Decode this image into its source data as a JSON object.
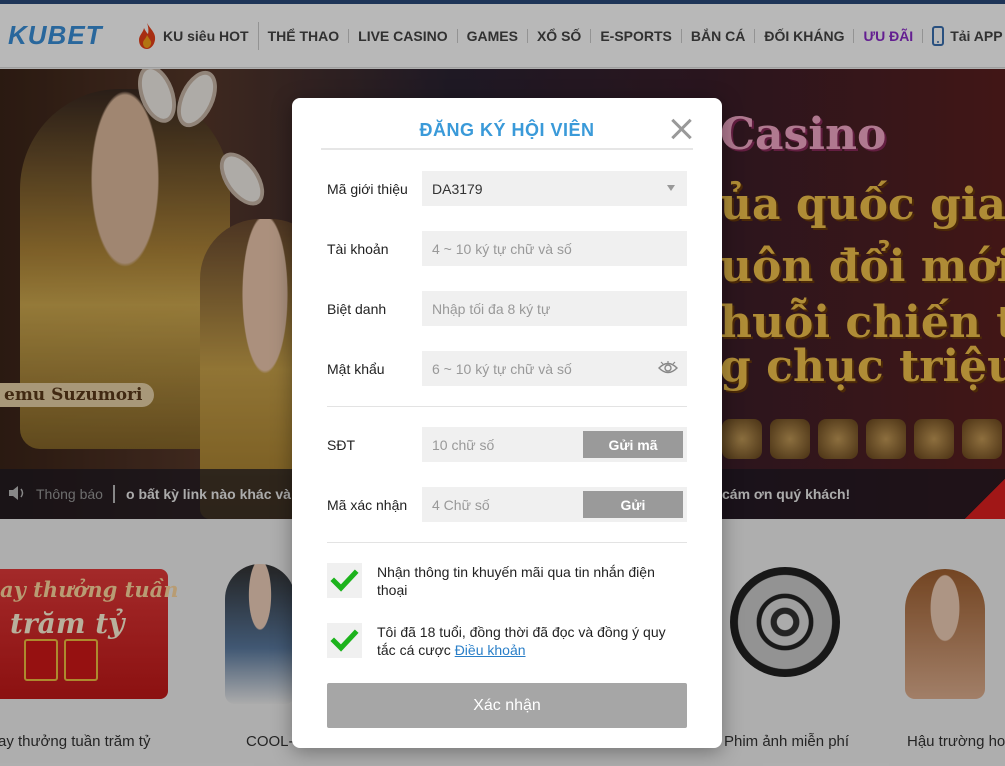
{
  "brand": {
    "logo_text": "KUBET"
  },
  "nav": {
    "items": [
      {
        "label": "KU siêu HOT",
        "icon": "fire-icon"
      },
      {
        "label": "THỂ THAO"
      },
      {
        "label": "LIVE CASINO"
      },
      {
        "label": "GAMES"
      },
      {
        "label": "XỔ SỐ"
      },
      {
        "label": "E-SPORTS"
      },
      {
        "label": "BẮN CÁ"
      },
      {
        "label": "ĐỐI KHÁNG"
      },
      {
        "label": "ƯU ĐÃI",
        "color": "#8b2cc9"
      },
      {
        "label": "Tải APP",
        "icon": "phone-icon"
      }
    ]
  },
  "banner": {
    "name_tag": "emu Suzumori",
    "headline_lines": [
      "Casino",
      "ủa quốc gia",
      "uôn đổi mới",
      "huỗi chiến th",
      "g chục triệu"
    ]
  },
  "notice": {
    "label": "Thông báo",
    "text_left": "o bất kỳ link nào khác và",
    "text_right": "cám ơn quý khách!"
  },
  "cards": {
    "promo_line1": "ay thưởng tuần",
    "promo_line2": "trăm tỷ",
    "labels": [
      "ay thưởng tuần trăm tỷ",
      "COOL-",
      "Phim ảnh miễn phí",
      "Hậu trường ho"
    ]
  },
  "modal": {
    "title": "ĐĂNG KÝ HỘI VIÊN",
    "referral": {
      "label": "Mã giới thiệu",
      "value": "DA3179"
    },
    "account": {
      "label": "Tài khoản",
      "placeholder": "4 ~ 10 ký tự chữ và số"
    },
    "nickname": {
      "label": "Biệt danh",
      "placeholder": "Nhập tối đa 8 ký tự"
    },
    "password": {
      "label": "Mật khẩu",
      "placeholder": "6 ~ 10 ký tự chữ và số"
    },
    "phone": {
      "label": "SĐT",
      "placeholder": "10 chữ số",
      "button": "Gửi mã"
    },
    "code": {
      "label": "Mã xác nhận",
      "placeholder": "4 Chữ số",
      "button": "Gửi"
    },
    "consent1": "Nhận thông tin khuyến mãi qua tin nhắn điện thoại",
    "consent2_text": "Tôi đã 18 tuổi, đồng thời đã đọc và đồng ý quy tắc cá cược ",
    "consent2_link": "Điều khoản",
    "submit": "Xác nhận"
  },
  "colors": {
    "title_blue": "#3a9ad9",
    "check_green": "#1db31d",
    "promo_purple": "#8b2cc9"
  }
}
